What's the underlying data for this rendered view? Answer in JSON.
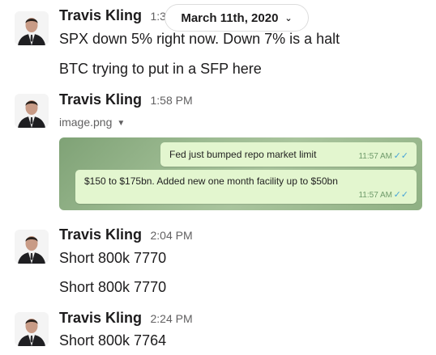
{
  "date_divider": {
    "label": "March 11th, 2020"
  },
  "messages": [
    {
      "author": "Travis Kling",
      "time": "1:3",
      "lines": [
        "SPX down 5% right now. Down 7% is a halt",
        "BTC trying to put in a SFP here"
      ]
    },
    {
      "author": "Travis Kling",
      "time": "1:58 PM",
      "attachment": {
        "filename": "image.png"
      }
    },
    {
      "author": "Travis Kling",
      "time": "2:04 PM",
      "lines": [
        "Short 800k 7770",
        "Short 800k 7770"
      ]
    },
    {
      "author": "Travis Kling",
      "time": "2:24 PM",
      "lines": [
        "Short 800k 7764"
      ]
    }
  ],
  "image_preview": {
    "bubbles": [
      {
        "text": "Fed just bumped repo market limit",
        "time": "11:57 AM"
      },
      {
        "text": "$150 to $175bn. Added new one month facility up to $50bn",
        "time": "11:57 AM"
      }
    ]
  },
  "colors": {
    "bubble_bg": "#e3f6cf",
    "read_check": "#47a4d8",
    "timestamp": "#616061"
  },
  "icons": [
    "avatar",
    "chevron-down-icon",
    "caret-down-icon",
    "double-check-icon"
  ]
}
